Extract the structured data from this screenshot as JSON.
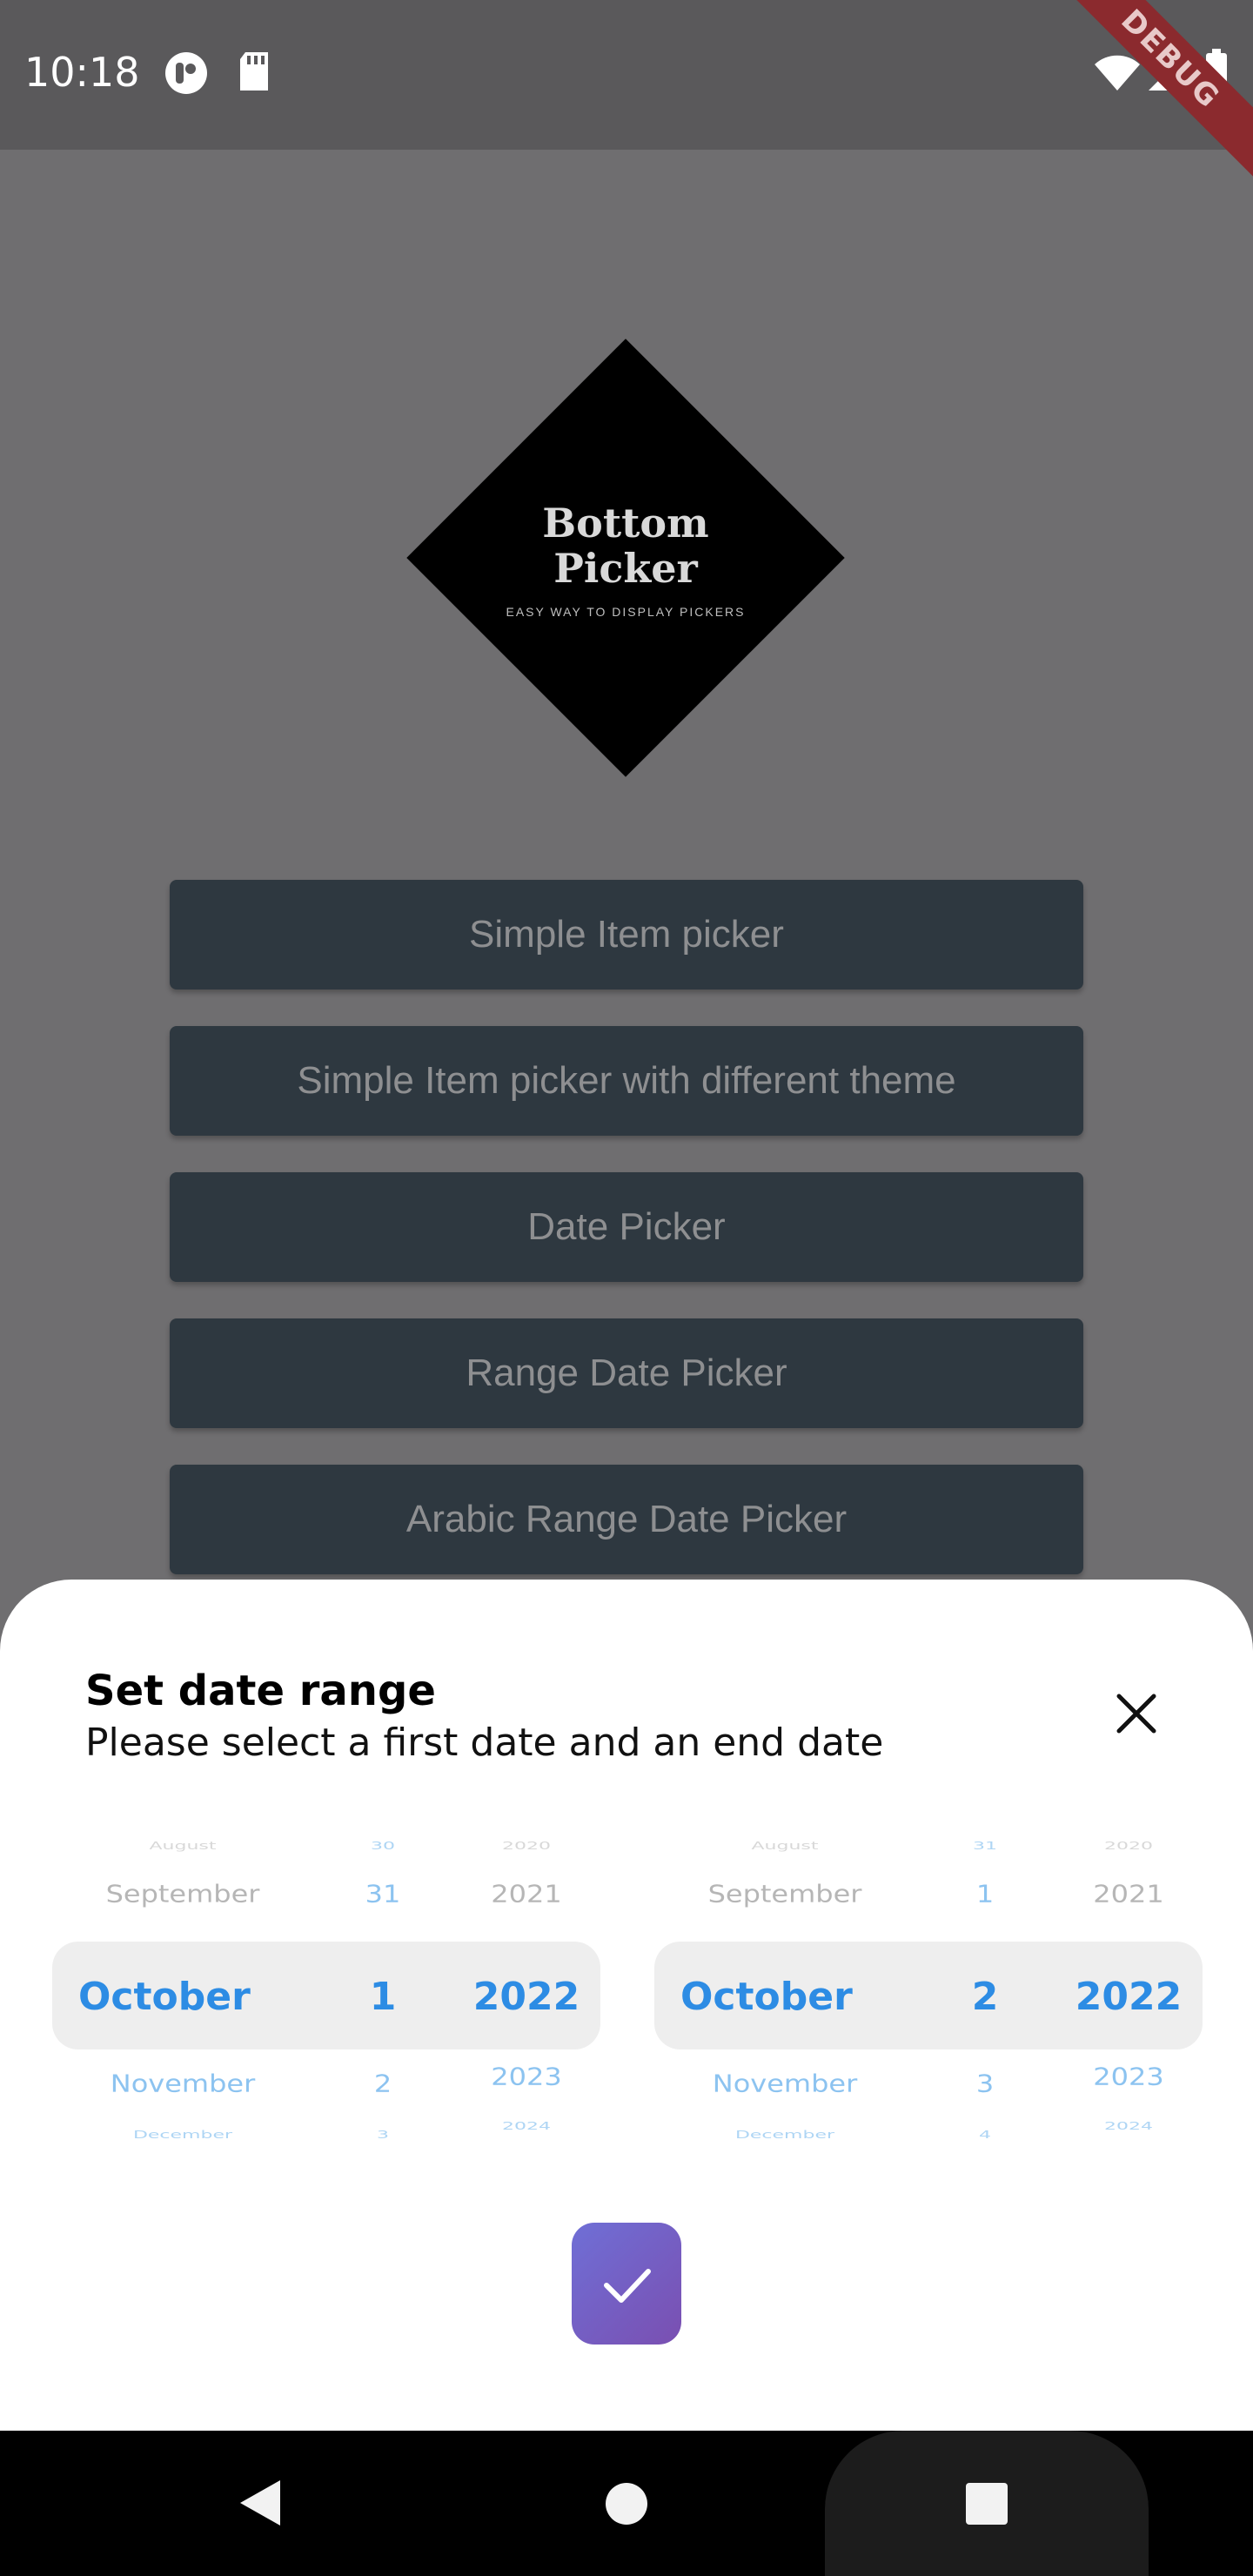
{
  "status_bar": {
    "time": "10:18",
    "icons_left": [
      "notification-badge-icon",
      "sd-card-icon"
    ],
    "icons_right": [
      "wifi-icon",
      "cellular-signal-icon",
      "battery-icon"
    ],
    "debug_label": "DEBUG"
  },
  "logo": {
    "title_line1": "Bottom",
    "title_line2": "Picker",
    "tagline": "EASY WAY TO DISPLAY PICKERS"
  },
  "buttons": [
    {
      "label": "Simple Item picker"
    },
    {
      "label": "Simple Item picker with different theme"
    },
    {
      "label": "Date Picker"
    },
    {
      "label": "Range Date Picker"
    },
    {
      "label": "Arabic Range Date Picker"
    }
  ],
  "sheet": {
    "title": "Set date range",
    "subtitle": "Please select a first date and an end date",
    "close_icon": "close-icon",
    "confirm_icon": "check-icon"
  },
  "start_picker": {
    "months": [
      "August",
      "September",
      "October",
      "November",
      "December"
    ],
    "days": [
      "30",
      "31",
      "1",
      "2",
      "3"
    ],
    "years": [
      "2020",
      "2021",
      "2022",
      "2023",
      "2024"
    ]
  },
  "end_picker": {
    "months": [
      "August",
      "September",
      "October",
      "November",
      "December"
    ],
    "days": [
      "31",
      "1",
      "2",
      "3",
      "4"
    ],
    "years": [
      "2020",
      "2021",
      "2022",
      "2023",
      "2024"
    ]
  },
  "colors": {
    "accent": "#2d8ce4",
    "button_bg": "#2e3840",
    "confirm_gradient_start": "#6f6fd6",
    "confirm_gradient_end": "#7a4fb1"
  },
  "nav_icons": [
    "back-icon",
    "home-icon",
    "recents-icon"
  ]
}
